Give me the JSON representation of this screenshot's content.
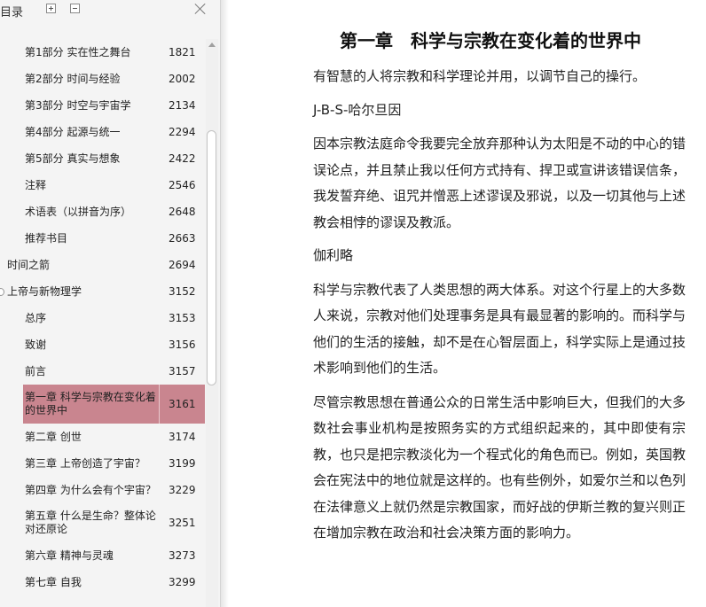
{
  "sidebar": {
    "title": "目录",
    "toc": [
      {
        "label": "第1部分 实在性之舞台",
        "page": "1821",
        "level": 2
      },
      {
        "label": "第2部分 时间与经验",
        "page": "2002",
        "level": 2
      },
      {
        "label": "第3部分 时空与宇宙学",
        "page": "2134",
        "level": 2
      },
      {
        "label": "第4部分 起源与统一",
        "page": "2294",
        "level": 2
      },
      {
        "label": "第5部分 真实与想象",
        "page": "2422",
        "level": 2
      },
      {
        "label": "注释",
        "page": "2546",
        "level": 2
      },
      {
        "label": "术语表（以拼音为序）",
        "page": "2648",
        "level": 2
      },
      {
        "label": "推荐书目",
        "page": "2663",
        "level": 2
      },
      {
        "label": "时间之箭",
        "page": "2694",
        "level": 1
      },
      {
        "label": "上帝与新物理学",
        "page": "3152",
        "level": 1
      },
      {
        "label": "总序",
        "page": "3153",
        "level": 2
      },
      {
        "label": "致谢",
        "page": "3156",
        "level": 2
      },
      {
        "label": "前言",
        "page": "3157",
        "level": 2
      },
      {
        "label": "第一章 科学与宗教在变化着的世界中",
        "page": "3161",
        "level": 2,
        "selected": true
      },
      {
        "label": "第二章 创世",
        "page": "3174",
        "level": 2
      },
      {
        "label": "第三章 上帝创造了宇宙？",
        "page": "3199",
        "level": 2
      },
      {
        "label": "第四章 为什么会有个宇宙？",
        "page": "3229",
        "level": 2
      },
      {
        "label": "第五章 什么是生命？整体论对还原论",
        "page": "3251",
        "level": 2
      },
      {
        "label": "第六章 精神与灵魂",
        "page": "3273",
        "level": 2
      },
      {
        "label": "第七章 自我",
        "page": "3299",
        "level": 2
      }
    ]
  },
  "reader": {
    "chapter_title": "第一章　科学与宗教在变化着的世界中",
    "paragraphs": [
      "有智慧的人将宗教和科学理论并用，以调节自己的操行。",
      "J-B-S-哈尔旦因",
      "因本宗教法庭命令我要完全放弃那种认为太阳是不动的中心的错误论点，并且禁止我以任何方式持有、捍卫或宣讲该错误信条，我发誓弃绝、诅咒并憎恶上述谬误及邪说，以及一切其他与上述教会相悖的谬误及教派。",
      "伽利略",
      "科学与宗教代表了人类思想的两大体系。对这个行星上的大多数人来说，宗教对他们处理事务是具有最显著的影响的。而科学与他们的生活的接触，却不是在心智层面上，科学实际上是通过技术影响到他们的生活。",
      "尽管宗教思想在普通公众的日常生活中影响巨大，但我们的大多数社会事业机构是按照务实的方式组织起来的，其中即使有宗教，也只是把宗教淡化为一个程式化的角色而已。例如，英国教会在宪法中的地位就是这样的。也有些例外，如爱尔兰和以色列在法律意义上就仍然是宗教国家，而好战的伊斯兰教的复兴则正在增加宗教在政治和社会决策方面的影响力。"
    ]
  },
  "colors": {
    "selected_row": "#c9858f",
    "sidebar_bg": "#f4f4f4"
  }
}
